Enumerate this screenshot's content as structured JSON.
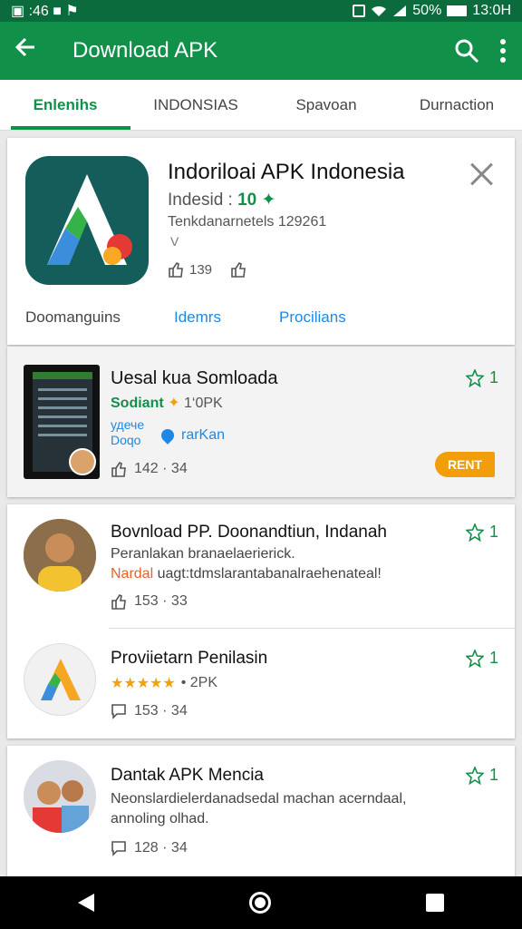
{
  "status": {
    "left": "▣ :46  ■  ⚑",
    "battery": "50%",
    "time": "13:0H"
  },
  "appbar": {
    "title": "Download APK",
    "back_icon": "arrow-left-icon",
    "search_icon": "search-icon",
    "menu_icon": "more-vert-icon"
  },
  "tabs": [
    "Enlenihs",
    "INDONSIAS",
    "Spavoan",
    "Durnaction"
  ],
  "hero": {
    "title": "Indoriloai APK Indonesia",
    "sub_label": "Indesid :",
    "sub_num": "10",
    "desc": "Tenkdanarnetels 129261",
    "extra": "V",
    "likes": "139",
    "links": [
      "Doomanguins",
      "Idemrs",
      "Procilians"
    ]
  },
  "featured": {
    "title": "Uesal kua Somloada",
    "dev": "Sodiant",
    "dev_badge": "✦",
    "dev_extra": "1‘0PK",
    "meta_top": "удече",
    "meta_bottom": "Doqo",
    "meta_place": "rarKan",
    "likes": "142 · 34",
    "rating": "1",
    "action": "RENT"
  },
  "list": [
    {
      "title": "Bovnload PP. Doonandtiun, Indanah",
      "line1": "Peranlakan branaelaerierick.",
      "line2_accent": "Nardal",
      "line2": " uagt:tdmslarantabanalraehenateal!",
      "likes": "153 · 33",
      "rating": "1"
    },
    {
      "title": "Proviietarn Penilasin",
      "stars": "★★★★★",
      "stars_count": "• 2PK",
      "likes": "153 · 34",
      "rating": "1"
    },
    {
      "title": "Dantak APK Mencia",
      "line1": "Neonslardielerdanadsedal machan acerndaal,",
      "line2": "annoling olhad.",
      "likes": "128 · 34",
      "rating": "1"
    }
  ],
  "colors": {
    "primary": "#11904a",
    "status": "#0b6b3c",
    "accent": "#1e88e5",
    "orange": "#f29e0b"
  }
}
